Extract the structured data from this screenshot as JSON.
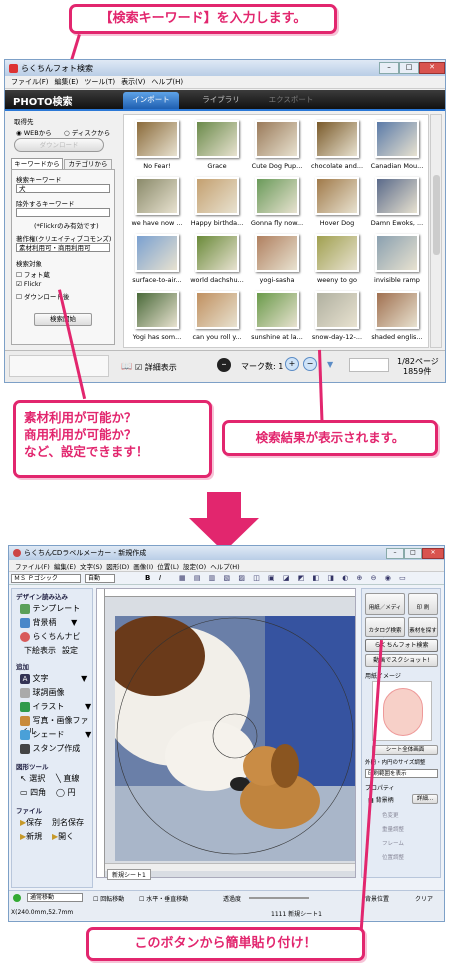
{
  "callouts": {
    "top": "【検索キーワード】を入力します。",
    "left": "素材利用が可能か？\n商用利用が可能か？\nなど、設定できます！",
    "right": "検索結果が表示されます。",
    "bottom": "このボタンから簡単貼り付け！"
  },
  "win1": {
    "title": "らくちんフォト検索",
    "menu": [
      "ファイル(F)",
      "編集(E)",
      "ツール(T)",
      "表示(V)",
      "ヘルプ(H)"
    ],
    "brand": "PHOTO検索",
    "tabs": [
      "インポート",
      "ライブラリ",
      "エクスポート"
    ],
    "source_label": "取得先",
    "source_opts": [
      "WEBから",
      "ディスクから"
    ],
    "download_btn": "ダウンロード",
    "search_tabs": [
      "キーワードから",
      "カテゴリから"
    ],
    "kw_label": "検索キーワード",
    "kw_value": "犬",
    "exclude_label": "除外するキーワード",
    "flickr_note": "(*Flickrのみ有効です)",
    "license_label": "著作権(クリエイティブコモンズ)",
    "license_value": "素材利用可・商用利用可",
    "target_label": "検索対象",
    "targets": [
      "フォト蔵",
      "Flickr",
      "ダウンロード後"
    ],
    "search_btn": "検索開始",
    "detail_label": "詳細表示",
    "mark_count": "マーク数: 1",
    "page": "1/82ページ",
    "total": "1859件",
    "thumbs": [
      "No Fear!",
      "Grace",
      "Cute Dog Pup...",
      "chocolate and...",
      "Canadian Mou...",
      "we have now ...",
      "Happy birthda...",
      "Gonna fly now...",
      "Hover Dog",
      "Damn Ewoks, ...",
      "surface-to-air...",
      "world dachshu...",
      "yogi-sasha",
      "weeny to go",
      "invisible ramp",
      "Yogi has som...",
      "can you roll y...",
      "sunshine at la...",
      "snow-day-12-...",
      "shaded englis..."
    ]
  },
  "win2": {
    "title": "らくちんCDラベルメーカー - 新規作成",
    "menu": [
      "ファイル(F)",
      "編集(E)",
      "文字(S)",
      "図形(D)",
      "画像(I)",
      "位置(L)",
      "設定(O)",
      "ヘルプ(H)"
    ],
    "font_name": "ＭＳ Ｐゴシック",
    "font_size": "自動",
    "left_sections": {
      "design": "デザイン読み込み",
      "design_items": [
        "テンプレート",
        "背景柄",
        "らくちんナビ"
      ],
      "design_extra": [
        "下絵表示",
        "設定"
      ],
      "add": "追加",
      "add_items": [
        "文字",
        "球詞画像",
        "イラスト",
        "写真・画像ファイル",
        "シェード",
        "スタンプ作成"
      ],
      "shape_tool": "図形ツール",
      "shape_items": [
        "選択",
        "直線",
        "四角",
        "円"
      ],
      "file": "ファイル",
      "file_items": [
        "保存",
        "別名保存",
        "新規",
        "開く"
      ]
    },
    "right_panel": {
      "btn_media": "用紙／メディア",
      "btn_print": "印 刷",
      "btn_catalog": "カタログ検索",
      "btn_material": "素材を探す",
      "btn_photo": "らくちんフォト検索",
      "btn_screenshot": "動画でスクショット!",
      "paper_image": "用紙イメージ",
      "sheet_full": "シート全体画面",
      "size_adjust": "外円・内円のサイズ調整",
      "print_mode": "印刷範囲を表示",
      "property": "プロパティ",
      "bg": "背景柄",
      "detail": "詳細...",
      "prop_rows": [
        "色変更",
        "重量調整",
        "フレーム",
        "位置調整"
      ]
    },
    "sheet_tab": "新規シート1",
    "status_left": "通常移動",
    "status_checks": [
      "回転移動",
      "水平・垂直移動"
    ],
    "transparency": "透過度",
    "bg_pos": "背景位置",
    "clear": "クリア",
    "coords": "X(240.0mm,52.7mm",
    "sheet_status": "1111 新規シート1"
  }
}
